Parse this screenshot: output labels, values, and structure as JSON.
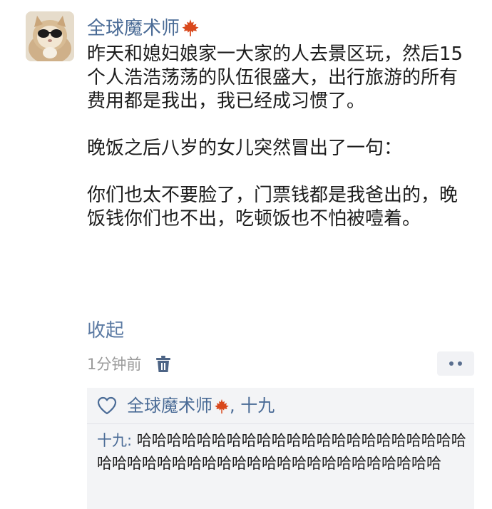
{
  "post": {
    "author": "全球魔术师",
    "avatar_icon": "cat-with-sunglasses-avatar",
    "author_badge_icon": "maple-leaf-icon",
    "paragraphs": [
      "昨天和媳妇娘家一大家的人去景区玩，然后15个人浩浩荡荡的队伍很盛大，出行旅游的所有费用都是我出，我已经成习惯了。",
      "晚饭之后八岁的女儿突然冒出了一句：",
      "你们也太不要脸了，门票钱都是我爸出的，晚饭钱你们也不出，吃顿饭也不怕被噎着。"
    ],
    "collapse_label": "收起",
    "time": "1分钟前",
    "delete_icon": "trash-icon",
    "more_icon": "more-dots-icon"
  },
  "likes": {
    "icon": "heart-outline-icon",
    "names_before_badge": "全球魔术师",
    "names_after_badge": ", 十九"
  },
  "comment": {
    "author": "十九",
    "separator": ": ",
    "text": "哈哈哈哈哈哈哈哈哈哈哈哈哈哈哈哈哈哈哈哈哈哈哈哈哈哈哈哈哈哈哈哈哈哈哈哈哈哈哈哈哈哈哈哈哈"
  },
  "colors": {
    "name_blue": "#4a6b96",
    "link_blue": "#5b7aa3",
    "meta_gray": "#9b9b9b",
    "panel_bg": "#f3f4f6",
    "leaf_red": "#d9481c"
  }
}
